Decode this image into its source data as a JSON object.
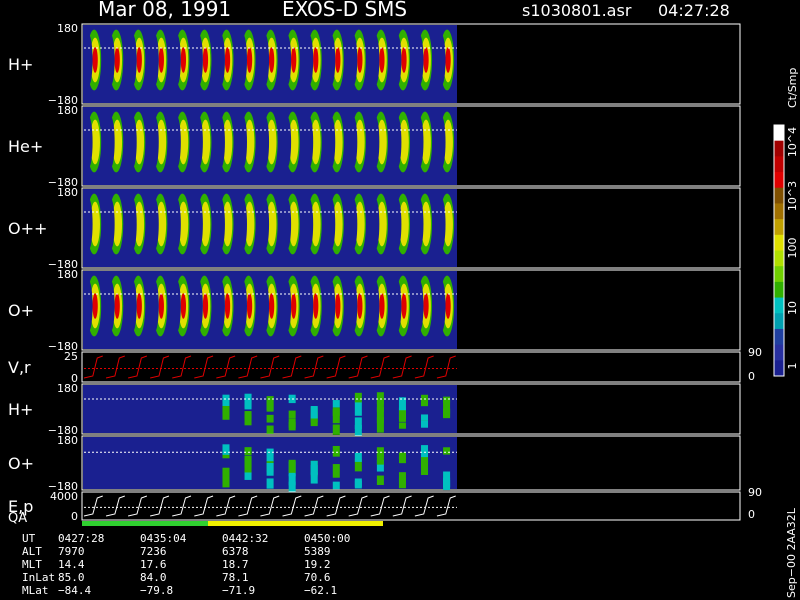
{
  "header": {
    "date": "Mar 08, 1991",
    "mission": "EXOS-D SMS",
    "file": "s1030801.asr",
    "time": "04:27:28"
  },
  "colorbar": {
    "unit": "Ct/Smp",
    "labels": [
      "10^4",
      "10^3",
      "100",
      "10",
      "1"
    ],
    "colors": [
      "#ffffff",
      "#a00000",
      "#c00000",
      "#e00000",
      "#805000",
      "#a07000",
      "#c0a000",
      "#e0e000",
      "#b0e000",
      "#70d000",
      "#30b000",
      "#00c0c0",
      "#00a0b0",
      "#2040a0",
      "#2830a0",
      "#1a2090"
    ]
  },
  "chart_data": [
    {
      "type": "heatmap",
      "name": "H+",
      "ylabel": "H+",
      "ylim": [
        -180,
        180
      ],
      "yticks": [
        "180",
        "−180"
      ],
      "coverage": 0.57,
      "intensity": "high"
    },
    {
      "type": "heatmap",
      "name": "He+",
      "ylabel": "He+",
      "ylim": [
        -180,
        180
      ],
      "yticks": [
        "180",
        "−180"
      ],
      "coverage": 0.57,
      "intensity": "medium"
    },
    {
      "type": "heatmap",
      "name": "O++",
      "ylabel": "O++",
      "ylim": [
        -180,
        180
      ],
      "yticks": [
        "180",
        "−180"
      ],
      "coverage": 0.57,
      "intensity": "medium"
    },
    {
      "type": "heatmap",
      "name": "O+",
      "ylabel": "O+",
      "ylim": [
        -180,
        180
      ],
      "yticks": [
        "180",
        "−180"
      ],
      "coverage": 0.57,
      "intensity": "high"
    },
    {
      "type": "line",
      "name": "V,r",
      "ylabel": "V,r",
      "yticks": [
        "25",
        "0"
      ],
      "right_ticks": [
        "90",
        "0"
      ]
    },
    {
      "type": "heatmap",
      "name": "H+ (low energy)",
      "ylabel": "H+",
      "ylim": [
        -180,
        180
      ],
      "yticks": [
        "180",
        "−180"
      ],
      "coverage": 0.57,
      "intensity": "low"
    },
    {
      "type": "heatmap",
      "name": "O+ (low energy)",
      "ylabel": "O+",
      "ylim": [
        -180,
        180
      ],
      "yticks": [
        "180",
        "−180"
      ],
      "coverage": 0.57,
      "intensity": "low"
    },
    {
      "type": "line",
      "name": "E,p",
      "ylabel": "E,p",
      "yticks": [
        "4000",
        "0"
      ],
      "right_ticks": [
        "90",
        "0"
      ]
    }
  ],
  "qa": {
    "label": "QA",
    "segments": [
      "green",
      "yellow"
    ]
  },
  "footer": {
    "rows": [
      {
        "label": "UT",
        "values": [
          "0427:28",
          "0435:04",
          "0442:32",
          "0450:00"
        ]
      },
      {
        "label": "ALT",
        "values": [
          "7970",
          "7236",
          "6378",
          "5389"
        ]
      },
      {
        "label": "MLT",
        "values": [
          "14.4",
          "17.6",
          "18.7",
          "19.2"
        ]
      },
      {
        "label": "InLat",
        "values": [
          "85.0",
          "84.0",
          "78.1",
          "70.6"
        ]
      },
      {
        "label": "MLat",
        "values": [
          "−84.4",
          "−79.8",
          "−71.9",
          "−62.1"
        ]
      }
    ],
    "side_label": "Sep−00  2AA32L"
  }
}
